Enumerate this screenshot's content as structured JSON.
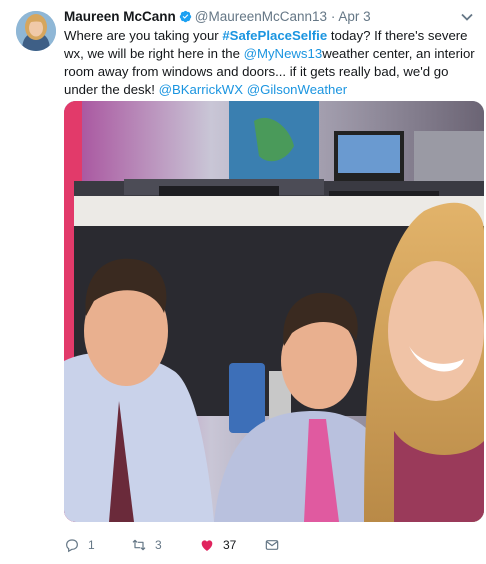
{
  "tweet": {
    "author_name": "Maureen McCann",
    "handle": "@MaureenMcCann13",
    "separator": "·",
    "date": "Apr 3",
    "text": {
      "part1": "Where are you taking your ",
      "hashtag": "#SafePlaceSelfie",
      "part2": " today? If there's severe wx, we will be right here in the ",
      "mention1": "@MyNews13",
      "part3": "weather center, an interior room away from windows and doors... if it gets really bad, we'd go under the desk! ",
      "mention2": "@BKarrickWX",
      "part4": " ",
      "mention3": "@GilsonWeather"
    }
  },
  "actions": {
    "reply_count": "1",
    "retweet_count": "3",
    "like_count": "37"
  },
  "icons": {
    "verified": "verified-badge-icon",
    "caret": "chevron-down-icon",
    "reply": "reply-icon",
    "retweet": "retweet-icon",
    "like": "heart-icon",
    "dm": "envelope-icon"
  },
  "colors": {
    "link": "#1b95e0",
    "like": "#e0245e",
    "muted": "#657786"
  }
}
